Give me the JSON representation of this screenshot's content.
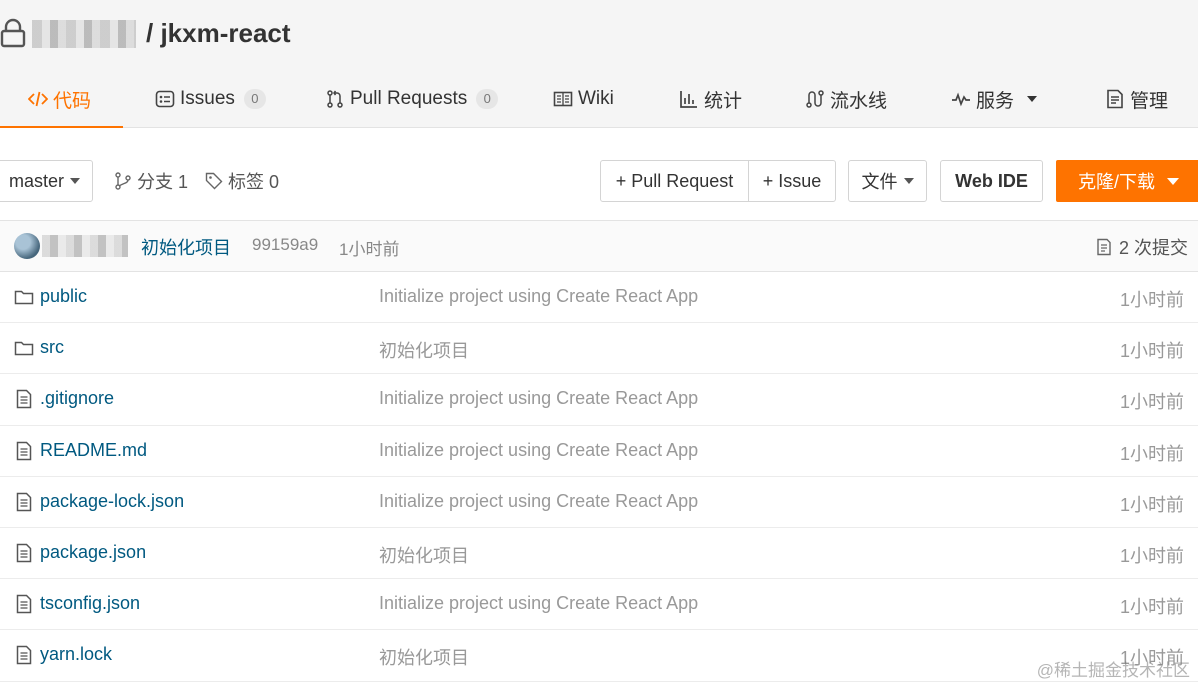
{
  "header": {
    "owner": "",
    "repo_title": "/ jkxm-react"
  },
  "tabs": [
    {
      "label": "代码",
      "icon": "code-icon",
      "active": true
    },
    {
      "label": "Issues",
      "badge": "0",
      "icon": "issues-icon"
    },
    {
      "label": "Pull Requests",
      "badge": "0",
      "icon": "pull-request-icon"
    },
    {
      "label": "Wiki",
      "icon": "book-icon"
    },
    {
      "label": "统计",
      "icon": "bar-chart-icon"
    },
    {
      "label": "流水线",
      "icon": "pipeline-icon"
    },
    {
      "label": "服务",
      "icon": "pulse-icon"
    },
    {
      "label": "管理",
      "icon": "settings-doc-icon"
    }
  ],
  "toolbar": {
    "branch": "master",
    "branches_label": "分支 1",
    "tags_label": "标签 0",
    "new_pr": "+ Pull Request",
    "new_issue": "+ Issue",
    "file_menu": "文件",
    "web_ide": "Web IDE",
    "clone": "克隆/下载"
  },
  "commit": {
    "message": "初始化项目",
    "sha": "99159a9",
    "time": "1小时前",
    "count": "2 次提交"
  },
  "files": [
    {
      "name": "public",
      "type": "folder",
      "message": "Initialize project using Create React App",
      "time": "1小时前"
    },
    {
      "name": "src",
      "type": "folder",
      "message": "初始化项目",
      "time": "1小时前"
    },
    {
      "name": ".gitignore",
      "type": "file",
      "message": "Initialize project using Create React App",
      "time": "1小时前"
    },
    {
      "name": "README.md",
      "type": "file",
      "message": "Initialize project using Create React App",
      "time": "1小时前"
    },
    {
      "name": "package-lock.json",
      "type": "file",
      "message": "Initialize project using Create React App",
      "time": "1小时前"
    },
    {
      "name": "package.json",
      "type": "file",
      "message": "初始化项目",
      "time": "1小时前"
    },
    {
      "name": "tsconfig.json",
      "type": "file",
      "message": "Initialize project using Create React App",
      "time": "1小时前"
    },
    {
      "name": "yarn.lock",
      "type": "file",
      "message": "初始化项目",
      "time": "1小时前"
    }
  ],
  "watermark": "@稀土掘金技术社区",
  "colors": {
    "accent": "#fe7300",
    "link": "#005980"
  }
}
